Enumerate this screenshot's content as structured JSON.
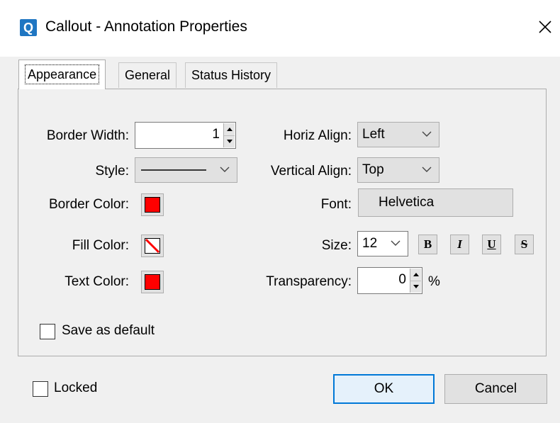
{
  "window": {
    "title": "Callout - Annotation Properties",
    "app_icon_letter": "Q"
  },
  "tabs": [
    {
      "label": "Appearance",
      "active": true
    },
    {
      "label": "General",
      "active": false
    },
    {
      "label": "Status History",
      "active": false
    }
  ],
  "appearance": {
    "border_width": {
      "label": "Border Width:",
      "value": "1"
    },
    "style": {
      "label": "Style:"
    },
    "border_color": {
      "label": "Border Color:",
      "color": "#ff0000"
    },
    "fill_color": {
      "label": "Fill Color:",
      "value": "none"
    },
    "text_color": {
      "label": "Text Color:",
      "color": "#ff0000"
    },
    "horiz_align": {
      "label": "Horiz Align:",
      "value": "Left"
    },
    "vertical_align": {
      "label": "Vertical Align:",
      "value": "Top"
    },
    "font": {
      "label": "Font:",
      "value": "Helvetica"
    },
    "size": {
      "label": "Size:",
      "value": "12"
    },
    "format_buttons": {
      "bold": "B",
      "italic": "I",
      "underline": "U",
      "strike": "S"
    },
    "transparency": {
      "label": "Transparency:",
      "value": "0",
      "unit": "%"
    },
    "save_default": {
      "label": "Save as default",
      "checked": false
    }
  },
  "footer": {
    "locked": {
      "label": "Locked",
      "checked": false
    },
    "ok_label": "OK",
    "cancel_label": "Cancel"
  },
  "colors": {
    "accent": "#0078d7",
    "swatch_red": "#ff0000"
  },
  "icons": [
    "app-icon",
    "close-icon",
    "chevron-down-icon",
    "spin-up-icon",
    "spin-down-icon",
    "no-fill-icon"
  ]
}
